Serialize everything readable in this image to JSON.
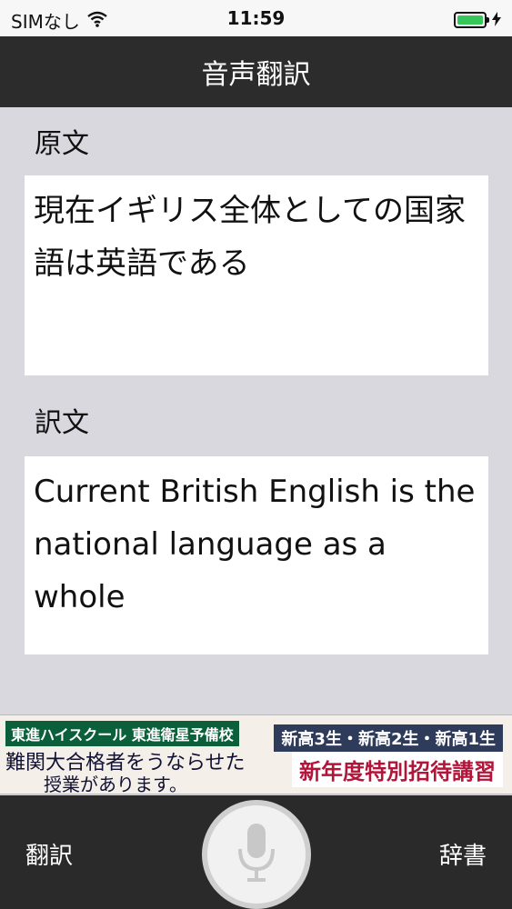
{
  "status_bar": {
    "carrier": "SIMなし",
    "time": "11:59"
  },
  "nav": {
    "title": "音声翻訳"
  },
  "source": {
    "label": "原文",
    "text": "現在イギリス全体としての国家語は英語である"
  },
  "translation": {
    "label": "訳文",
    "text": "Current British English is the national language as a whole"
  },
  "ad": {
    "line1": "東進ハイスクール 東進衛星予備校",
    "line2": "難関大合格者をうならせた",
    "line3": "授業があります。",
    "right1": "新高3生・新高2生・新高1生",
    "right2": "新年度特別招待講習"
  },
  "bottom": {
    "left_label": "翻訳",
    "right_label": "辞書"
  },
  "colors": {
    "nav_bg": "#2c2c2c",
    "page_bg": "#d9d8df",
    "battery": "#35c759"
  }
}
